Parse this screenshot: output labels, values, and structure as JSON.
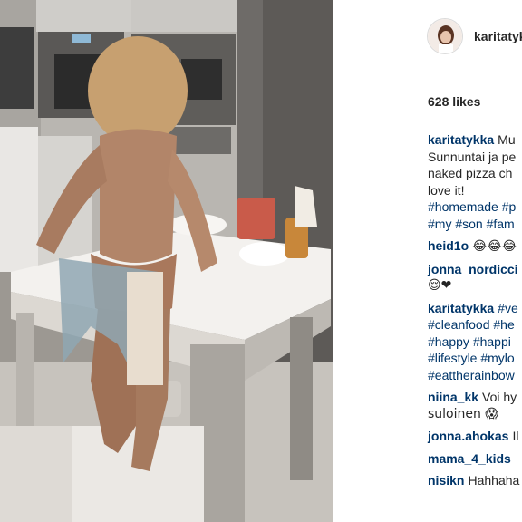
{
  "post": {
    "author": "karitatykka",
    "likes": "628 likes"
  },
  "comments": [
    {
      "user": "karitatykka",
      "lines": [
        "Mu",
        "Sunnuntai ja pe",
        "naked pizza ch",
        "love it!"
      ],
      "tags": [
        "#homemade #p",
        "#my #son #fam"
      ]
    },
    {
      "user": "heid1o",
      "lines": [
        "😂😂😂"
      ]
    },
    {
      "user": "jonna_nordicci",
      "lines": [
        "",
        "😌❤"
      ]
    },
    {
      "user": "karitatykka",
      "lines": [
        "#ve"
      ],
      "tags": [
        "#cleanfood #he",
        "#happy #happi",
        "#lifestyle #mylo",
        "#eattherainbow"
      ]
    },
    {
      "user": "niina_kk",
      "lines": [
        "Voi hy",
        "suloinen 😱"
      ]
    },
    {
      "user": "jonna.ahokas",
      "lines": [
        "Il"
      ]
    },
    {
      "user": "mama_4_kids",
      "lines": [
        ""
      ]
    },
    {
      "user": "nisikn",
      "lines": [
        "Hahhaha"
      ]
    }
  ]
}
